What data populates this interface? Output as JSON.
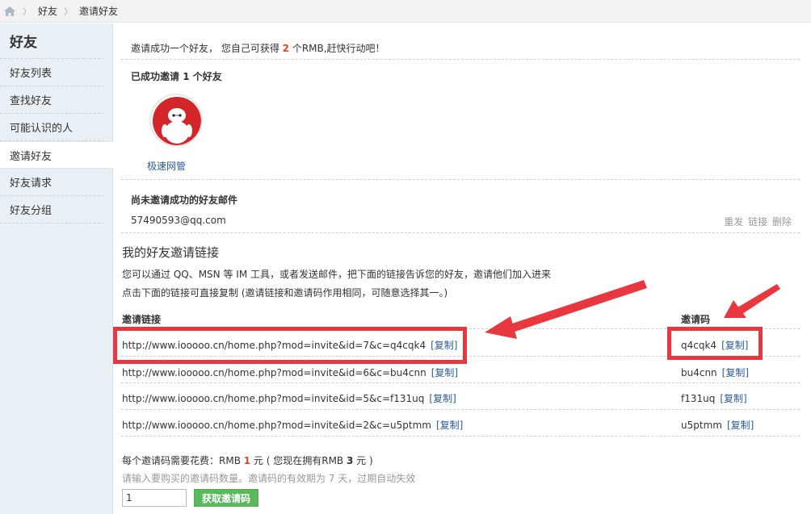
{
  "breadcrumb": {
    "items": [
      "好友",
      "邀请好友"
    ]
  },
  "sidebar": {
    "title": "好友",
    "items": [
      {
        "label": "好友列表"
      },
      {
        "label": "查找好友"
      },
      {
        "label": "可能认识的人"
      },
      {
        "label": "邀请好友",
        "active": true
      },
      {
        "label": "好友请求"
      },
      {
        "label": "好友分组"
      }
    ]
  },
  "notice": {
    "prefix": "邀请成功一个好友， 您自己可获得 ",
    "amount": "2",
    "suffix": " 个RMB,赶快行动吧！"
  },
  "invited": {
    "prefix": "已成功邀请 ",
    "count": "1",
    "suffix": " 个好友",
    "friend_name": "极速网管"
  },
  "pending": {
    "heading": "尚未邀请成功的好友邮件",
    "email": "57490593@qq.com",
    "actions": [
      "重发",
      "链接",
      "删除"
    ]
  },
  "links_section": {
    "title": "我的好友邀请链接",
    "desc1": "您可以通过 QQ、MSN 等 IM 工具，或者发送邮件，把下面的链接告诉您的好友，邀请他们加入进来",
    "desc2": "点击下面的链接可直接复制 (邀请链接和邀请码作用相同，可随意选择其一。)",
    "col_link": "邀请链接",
    "col_code": "邀请码",
    "copy_label": "[复制]",
    "rows": [
      {
        "url": "http://www.iooooo.cn/home.php?mod=invite&id=7&c=q4cqk4",
        "code": "q4cqk4"
      },
      {
        "url": "http://www.iooooo.cn/home.php?mod=invite&id=6&c=bu4cnn",
        "code": "bu4cnn"
      },
      {
        "url": "http://www.iooooo.cn/home.php?mod=invite&id=5&c=f131uq",
        "code": "f131uq"
      },
      {
        "url": "http://www.iooooo.cn/home.php?mod=invite&id=2&c=u5ptmm",
        "code": "u5ptmm"
      }
    ]
  },
  "purchase": {
    "cost_prefix": "每个邀请码需要花费：RMB ",
    "cost_value": "1",
    "cost_mid": " 元 ( 您现在拥有RMB ",
    "balance": "3",
    "cost_suffix": " 元 )",
    "hint": "请输入要购买的邀请码数量。邀请码的有效期为 7 天，过期自动失效",
    "quantity": "1",
    "button": "获取邀请码"
  },
  "colors": {
    "accent_red": "#e8373e",
    "link_blue": "#2a5b9b",
    "button_green": "#5cb85c"
  }
}
